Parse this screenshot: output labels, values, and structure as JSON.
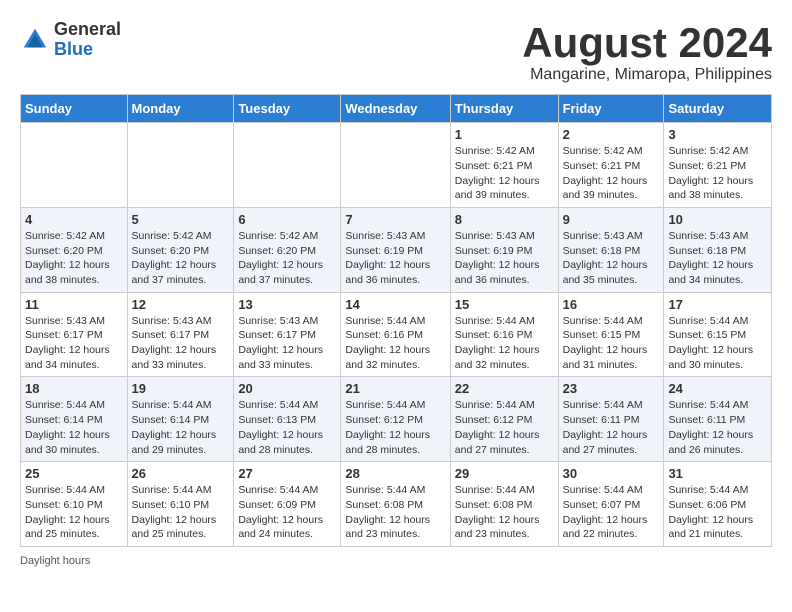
{
  "header": {
    "logo_general": "General",
    "logo_blue": "Blue",
    "month_title": "August 2024",
    "location": "Mangarine, Mimaropa, Philippines"
  },
  "days_of_week": [
    "Sunday",
    "Monday",
    "Tuesday",
    "Wednesday",
    "Thursday",
    "Friday",
    "Saturday"
  ],
  "weeks": [
    [
      {
        "day": "",
        "info": ""
      },
      {
        "day": "",
        "info": ""
      },
      {
        "day": "",
        "info": ""
      },
      {
        "day": "",
        "info": ""
      },
      {
        "day": "1",
        "info": "Sunrise: 5:42 AM\nSunset: 6:21 PM\nDaylight: 12 hours and 39 minutes."
      },
      {
        "day": "2",
        "info": "Sunrise: 5:42 AM\nSunset: 6:21 PM\nDaylight: 12 hours and 39 minutes."
      },
      {
        "day": "3",
        "info": "Sunrise: 5:42 AM\nSunset: 6:21 PM\nDaylight: 12 hours and 38 minutes."
      }
    ],
    [
      {
        "day": "4",
        "info": "Sunrise: 5:42 AM\nSunset: 6:20 PM\nDaylight: 12 hours and 38 minutes."
      },
      {
        "day": "5",
        "info": "Sunrise: 5:42 AM\nSunset: 6:20 PM\nDaylight: 12 hours and 37 minutes."
      },
      {
        "day": "6",
        "info": "Sunrise: 5:42 AM\nSunset: 6:20 PM\nDaylight: 12 hours and 37 minutes."
      },
      {
        "day": "7",
        "info": "Sunrise: 5:43 AM\nSunset: 6:19 PM\nDaylight: 12 hours and 36 minutes."
      },
      {
        "day": "8",
        "info": "Sunrise: 5:43 AM\nSunset: 6:19 PM\nDaylight: 12 hours and 36 minutes."
      },
      {
        "day": "9",
        "info": "Sunrise: 5:43 AM\nSunset: 6:18 PM\nDaylight: 12 hours and 35 minutes."
      },
      {
        "day": "10",
        "info": "Sunrise: 5:43 AM\nSunset: 6:18 PM\nDaylight: 12 hours and 34 minutes."
      }
    ],
    [
      {
        "day": "11",
        "info": "Sunrise: 5:43 AM\nSunset: 6:17 PM\nDaylight: 12 hours and 34 minutes."
      },
      {
        "day": "12",
        "info": "Sunrise: 5:43 AM\nSunset: 6:17 PM\nDaylight: 12 hours and 33 minutes."
      },
      {
        "day": "13",
        "info": "Sunrise: 5:43 AM\nSunset: 6:17 PM\nDaylight: 12 hours and 33 minutes."
      },
      {
        "day": "14",
        "info": "Sunrise: 5:44 AM\nSunset: 6:16 PM\nDaylight: 12 hours and 32 minutes."
      },
      {
        "day": "15",
        "info": "Sunrise: 5:44 AM\nSunset: 6:16 PM\nDaylight: 12 hours and 32 minutes."
      },
      {
        "day": "16",
        "info": "Sunrise: 5:44 AM\nSunset: 6:15 PM\nDaylight: 12 hours and 31 minutes."
      },
      {
        "day": "17",
        "info": "Sunrise: 5:44 AM\nSunset: 6:15 PM\nDaylight: 12 hours and 30 minutes."
      }
    ],
    [
      {
        "day": "18",
        "info": "Sunrise: 5:44 AM\nSunset: 6:14 PM\nDaylight: 12 hours and 30 minutes."
      },
      {
        "day": "19",
        "info": "Sunrise: 5:44 AM\nSunset: 6:14 PM\nDaylight: 12 hours and 29 minutes."
      },
      {
        "day": "20",
        "info": "Sunrise: 5:44 AM\nSunset: 6:13 PM\nDaylight: 12 hours and 28 minutes."
      },
      {
        "day": "21",
        "info": "Sunrise: 5:44 AM\nSunset: 6:12 PM\nDaylight: 12 hours and 28 minutes."
      },
      {
        "day": "22",
        "info": "Sunrise: 5:44 AM\nSunset: 6:12 PM\nDaylight: 12 hours and 27 minutes."
      },
      {
        "day": "23",
        "info": "Sunrise: 5:44 AM\nSunset: 6:11 PM\nDaylight: 12 hours and 27 minutes."
      },
      {
        "day": "24",
        "info": "Sunrise: 5:44 AM\nSunset: 6:11 PM\nDaylight: 12 hours and 26 minutes."
      }
    ],
    [
      {
        "day": "25",
        "info": "Sunrise: 5:44 AM\nSunset: 6:10 PM\nDaylight: 12 hours and 25 minutes."
      },
      {
        "day": "26",
        "info": "Sunrise: 5:44 AM\nSunset: 6:10 PM\nDaylight: 12 hours and 25 minutes."
      },
      {
        "day": "27",
        "info": "Sunrise: 5:44 AM\nSunset: 6:09 PM\nDaylight: 12 hours and 24 minutes."
      },
      {
        "day": "28",
        "info": "Sunrise: 5:44 AM\nSunset: 6:08 PM\nDaylight: 12 hours and 23 minutes."
      },
      {
        "day": "29",
        "info": "Sunrise: 5:44 AM\nSunset: 6:08 PM\nDaylight: 12 hours and 23 minutes."
      },
      {
        "day": "30",
        "info": "Sunrise: 5:44 AM\nSunset: 6:07 PM\nDaylight: 12 hours and 22 minutes."
      },
      {
        "day": "31",
        "info": "Sunrise: 5:44 AM\nSunset: 6:06 PM\nDaylight: 12 hours and 21 minutes."
      }
    ]
  ],
  "footer": {
    "daylight_label": "Daylight hours"
  }
}
